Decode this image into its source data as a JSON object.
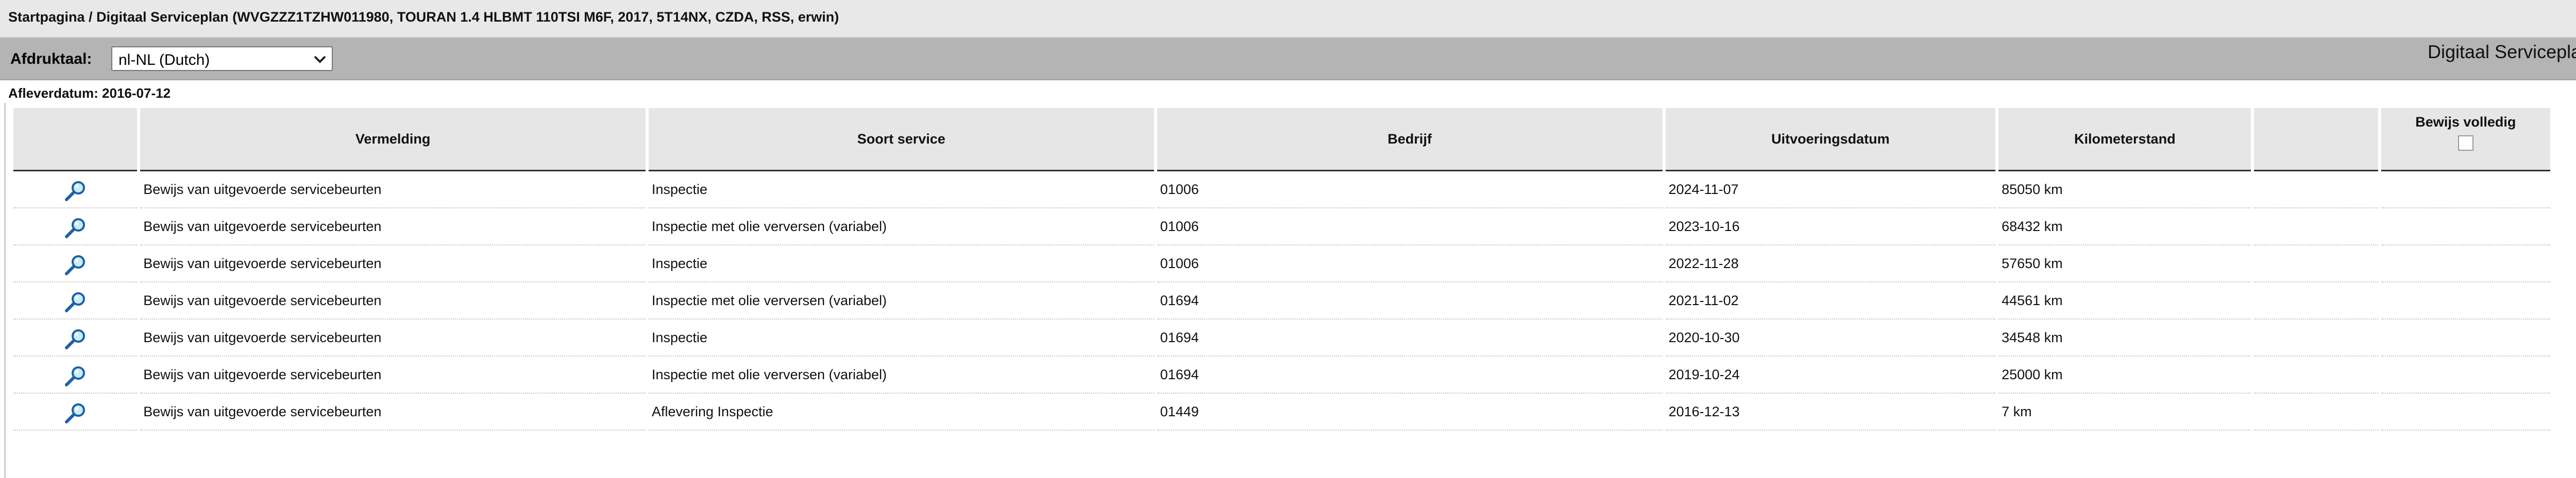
{
  "breadcrumb": "Startpagina / Digitaal Serviceplan (WVGZZZ1TZHW011980, TOURAN 1.4 HLBMT 110TSI M6F, 2017, 5T14NX, CZDA, RSS, erwin)",
  "toolbar": {
    "print_language_label": "Afdruktaal:",
    "print_language_value": "nl-NL (Dutch)",
    "panel_title": "Digitaal Serviceplan"
  },
  "delivery_date": "Afleverdatum: 2016-07-12",
  "table": {
    "headers": {
      "vermelding": "Vermelding",
      "soort_service": "Soort service",
      "bedrijf": "Bedrijf",
      "uitvoeringsdatum": "Uitvoeringsdatum",
      "kilometerstand": "Kilometerstand",
      "extra": "",
      "bewijs_volledig": "Bewijs volledig"
    },
    "rows": [
      {
        "vermelding": "Bewijs van uitgevoerde servicebeurten",
        "soort_service": "Inspectie",
        "bedrijf": "01006",
        "uitvoeringsdatum": "2024-11-07",
        "kilometerstand": "85050 km"
      },
      {
        "vermelding": "Bewijs van uitgevoerde servicebeurten",
        "soort_service": "Inspectie met olie verversen (variabel)",
        "bedrijf": "01006",
        "uitvoeringsdatum": "2023-10-16",
        "kilometerstand": "68432 km"
      },
      {
        "vermelding": "Bewijs van uitgevoerde servicebeurten",
        "soort_service": "Inspectie",
        "bedrijf": "01006",
        "uitvoeringsdatum": "2022-11-28",
        "kilometerstand": "57650 km"
      },
      {
        "vermelding": "Bewijs van uitgevoerde servicebeurten",
        "soort_service": "Inspectie met olie verversen (variabel)",
        "bedrijf": "01694",
        "uitvoeringsdatum": "2021-11-02",
        "kilometerstand": "44561 km"
      },
      {
        "vermelding": "Bewijs van uitgevoerde servicebeurten",
        "soort_service": "Inspectie",
        "bedrijf": "01694",
        "uitvoeringsdatum": "2020-10-30",
        "kilometerstand": "34548 km"
      },
      {
        "vermelding": "Bewijs van uitgevoerde servicebeurten",
        "soort_service": "Inspectie met olie verversen (variabel)",
        "bedrijf": "01694",
        "uitvoeringsdatum": "2019-10-24",
        "kilometerstand": "25000 km"
      },
      {
        "vermelding": "Bewijs van uitgevoerde servicebeurten",
        "soort_service": "Aflevering Inspectie",
        "bedrijf": "01449",
        "uitvoeringsdatum": "2016-12-13",
        "kilometerstand": "7 km"
      }
    ]
  },
  "icons": {
    "view": "magnifier-icon",
    "select": "chevron-down-icon",
    "checkbox": "checkbox-icon"
  },
  "colors": {
    "breadcrumb_bg": "#e8e8e8",
    "toolbar_bg": "#b4b4b4",
    "header_bg": "#e6e6e6",
    "magnifier_handle": "#1f5fa8",
    "magnifier_lens": "#c9eef2"
  }
}
